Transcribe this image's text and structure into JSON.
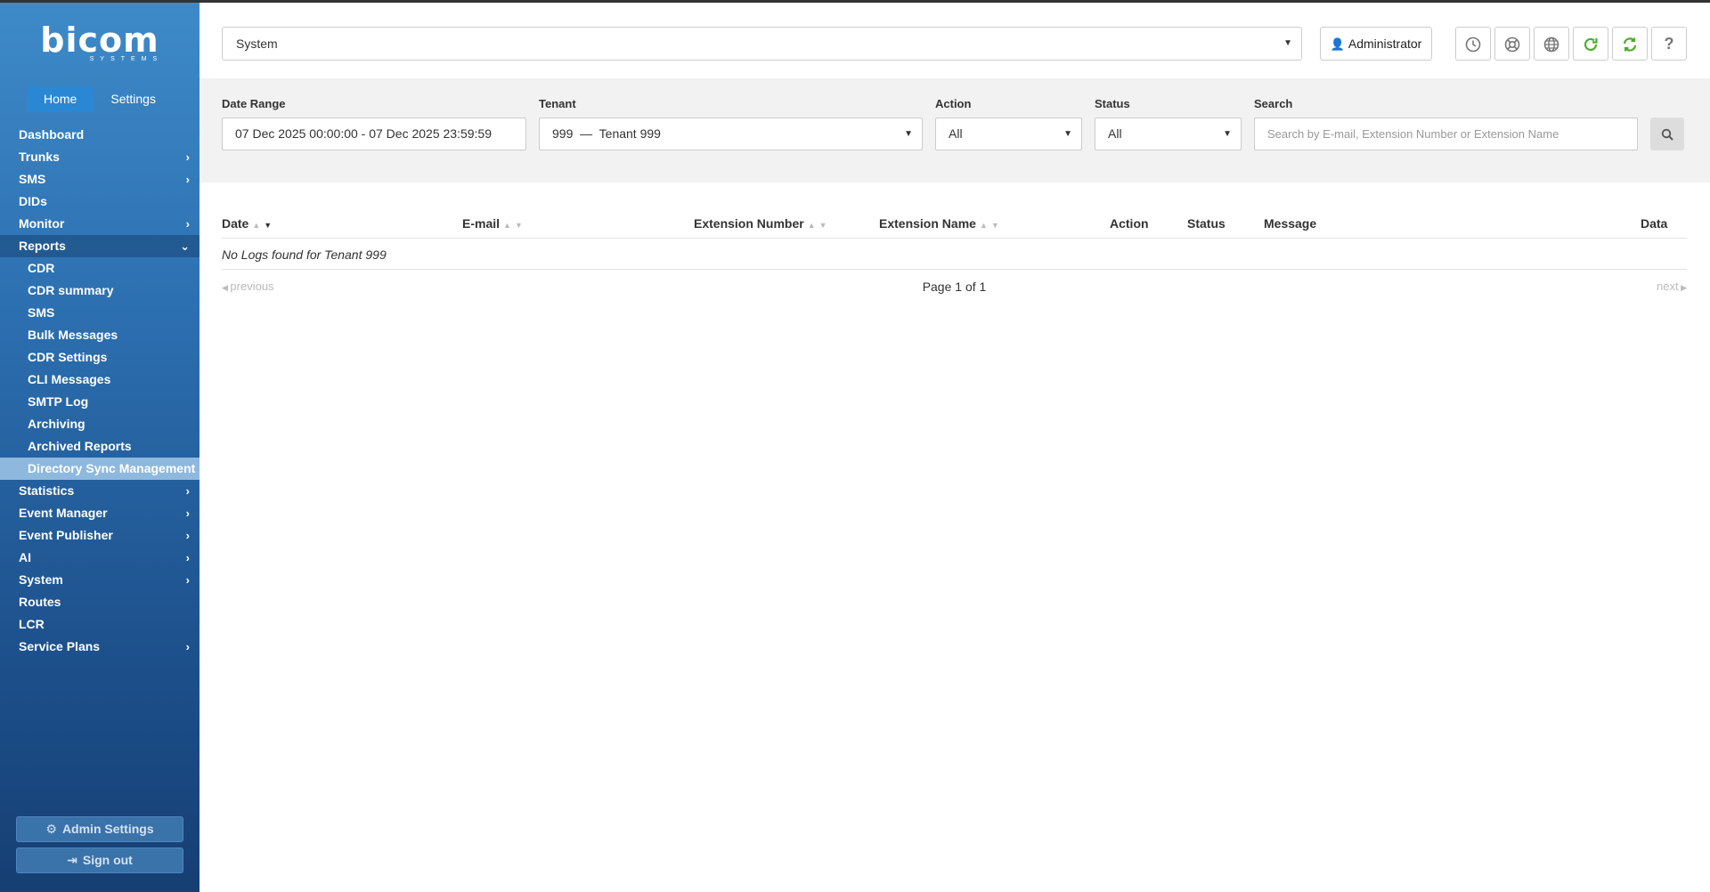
{
  "brand": {
    "name": "bicom",
    "sub": "SYSTEMS"
  },
  "sidebar": {
    "tabs": [
      {
        "label": "Home"
      },
      {
        "label": "Settings"
      }
    ],
    "items": [
      {
        "label": "Dashboard"
      },
      {
        "label": "Trunks"
      },
      {
        "label": "SMS"
      },
      {
        "label": "DIDs"
      },
      {
        "label": "Monitor"
      },
      {
        "label": "Reports"
      },
      {
        "label": "Statistics"
      },
      {
        "label": "Event Manager"
      },
      {
        "label": "Event Publisher"
      },
      {
        "label": "AI"
      },
      {
        "label": "System"
      },
      {
        "label": "Routes"
      },
      {
        "label": "LCR"
      },
      {
        "label": "Service Plans"
      }
    ],
    "report_items": [
      {
        "label": "CDR"
      },
      {
        "label": "CDR summary"
      },
      {
        "label": "SMS"
      },
      {
        "label": "Bulk Messages"
      },
      {
        "label": "CDR Settings"
      },
      {
        "label": "CLI Messages"
      },
      {
        "label": "SMTP Log"
      },
      {
        "label": "Archiving"
      },
      {
        "label": "Archived Reports"
      },
      {
        "label": "Directory Sync Management"
      }
    ],
    "admin_settings": "Admin Settings",
    "sign_out": "Sign out"
  },
  "header": {
    "system_select": "System",
    "user": "Administrator"
  },
  "filters": {
    "date_range_label": "Date Range",
    "date_range_value": "07 Dec 2025 00:00:00 - 07 Dec 2025 23:59:59",
    "tenant_label": "Tenant",
    "tenant_value": "999  —  Tenant 999",
    "action_label": "Action",
    "action_value": "All",
    "status_label": "Status",
    "status_value": "All",
    "search_label": "Search",
    "search_placeholder": "Search by E-mail, Extension Number or Extension Name"
  },
  "table": {
    "columns": {
      "date": "Date",
      "email": "E-mail",
      "ext_number": "Extension Number",
      "ext_name": "Extension Name",
      "action": "Action",
      "status": "Status",
      "message": "Message",
      "data": "Data"
    },
    "empty": "No Logs found for Tenant 999"
  },
  "pager": {
    "previous": "previous",
    "info": "Page 1 of 1",
    "next": "next"
  }
}
